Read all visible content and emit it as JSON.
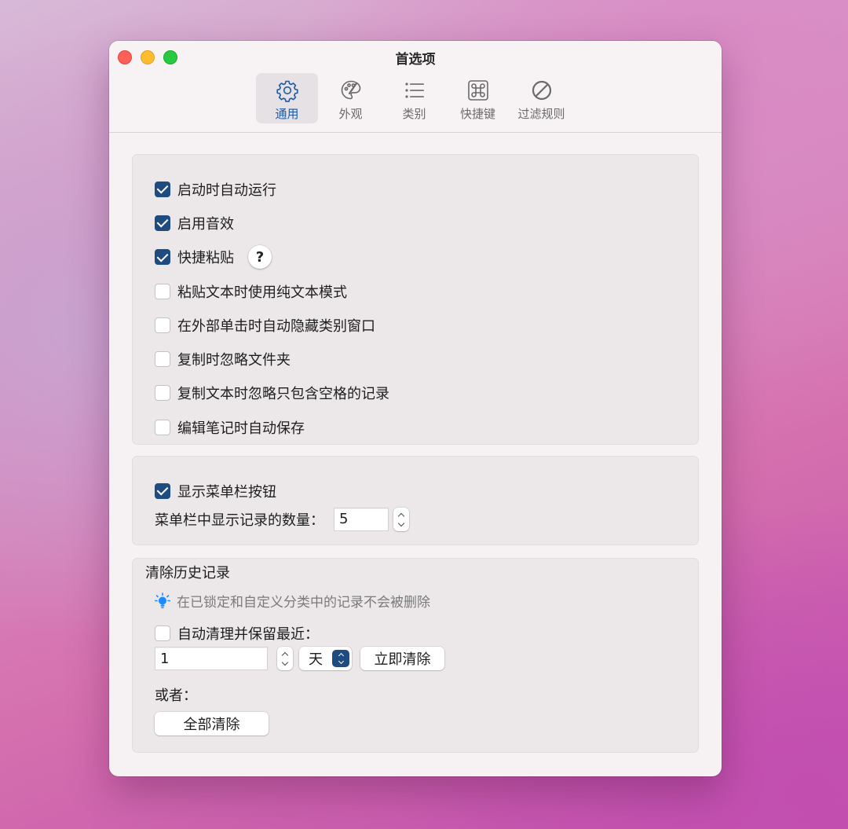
{
  "window": {
    "title": "首选项"
  },
  "tabs": [
    {
      "label": "通用",
      "icon": "gear-icon",
      "active": true
    },
    {
      "label": "外观",
      "icon": "palette-icon",
      "active": false
    },
    {
      "label": "类别",
      "icon": "list-icon",
      "active": false
    },
    {
      "label": "快捷键",
      "icon": "command-icon",
      "active": false
    },
    {
      "label": "过滤规则",
      "icon": "prohibit-icon",
      "active": false
    }
  ],
  "general": {
    "options": [
      {
        "label": "启动时自动运行",
        "checked": true
      },
      {
        "label": "启用音效",
        "checked": true
      },
      {
        "label": "快捷粘贴",
        "checked": true
      },
      {
        "label": "粘贴文本时使用纯文本模式",
        "checked": false
      },
      {
        "label": "在外部单击时自动隐藏类别窗口",
        "checked": false
      },
      {
        "label": "复制时忽略文件夹",
        "checked": false
      },
      {
        "label": "复制文本时忽略只包含空格的记录",
        "checked": false
      },
      {
        "label": "编辑笔记时自动保存",
        "checked": false
      }
    ],
    "help_label": "?"
  },
  "menubar": {
    "show_label": "显示菜单栏按钮",
    "show_checked": true,
    "count_label": "菜单栏中显示记录的数量：",
    "count_value": "5"
  },
  "history": {
    "title": "清除历史记录",
    "tip": "在已锁定和自定义分类中的记录不会被删除",
    "auto_label": "自动清理并保留最近：",
    "auto_checked": false,
    "keep_value": "1",
    "unit_value": "天",
    "clear_now_label": "立即清除",
    "or_label": "或者：",
    "clear_all_label": "全部清除"
  },
  "colors": {
    "accent": "#1f4c80",
    "tab_active_text": "#1d5aa6",
    "tip_bulb": "#1a8cff"
  }
}
